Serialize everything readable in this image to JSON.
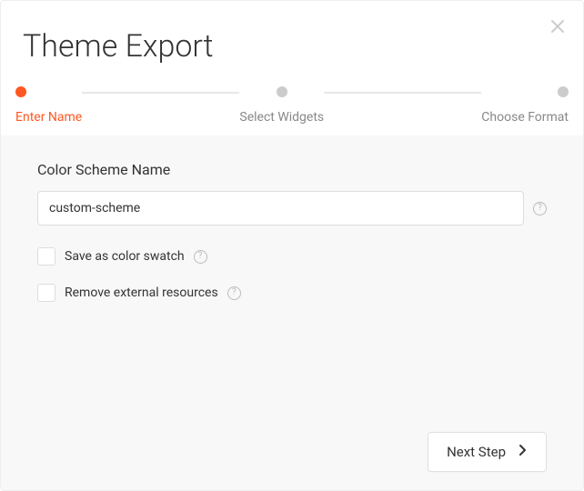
{
  "title": "Theme Export",
  "steps": {
    "s1": "Enter Name",
    "s2": "Select Widgets",
    "s3": "Choose Format"
  },
  "form": {
    "field_label": "Color Scheme Name",
    "scheme_name": "custom-scheme",
    "save_swatch_label": "Save as color swatch",
    "remove_external_label": "Remove external resources"
  },
  "actions": {
    "next_label": "Next Step"
  },
  "icons": {
    "help_glyph": "?"
  }
}
